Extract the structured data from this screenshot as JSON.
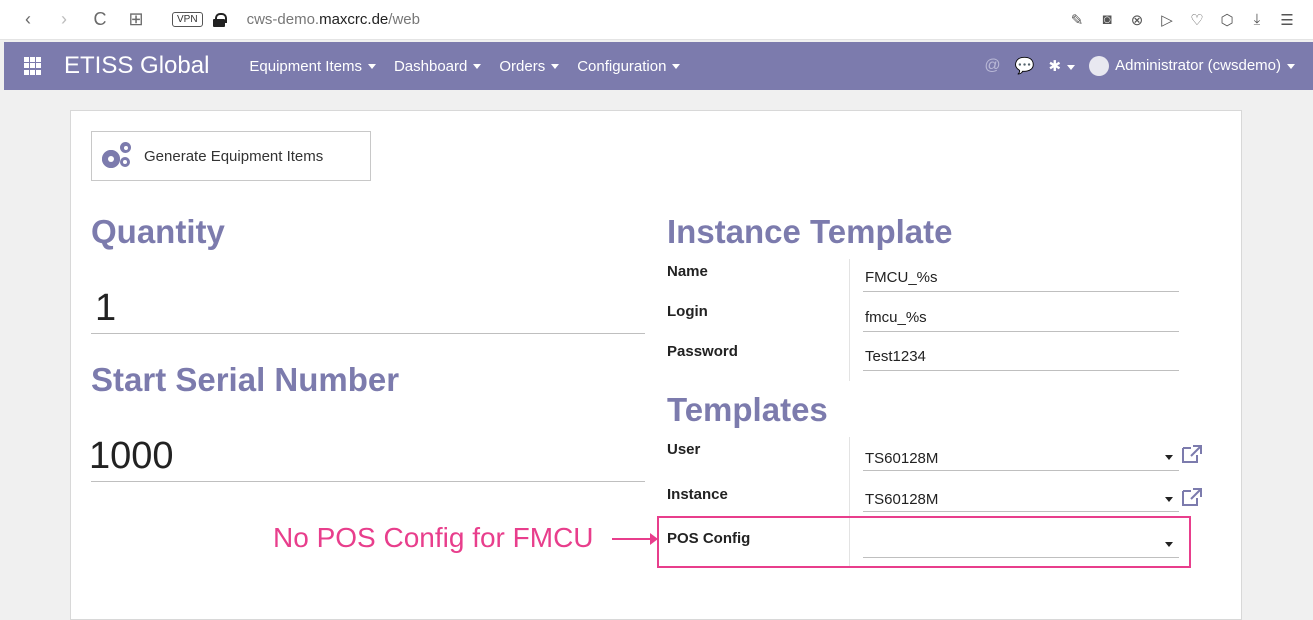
{
  "browser": {
    "back": "‹",
    "forward": "›",
    "reload": "C",
    "vpn_label": "VPN",
    "url_prefix": "cws-demo.",
    "url_domain": "maxcrc.de",
    "url_path": "/web"
  },
  "navbar": {
    "brand": "ETISS Global",
    "menu": [
      {
        "label": "Equipment Items"
      },
      {
        "label": "Dashboard"
      },
      {
        "label": "Orders"
      },
      {
        "label": "Configuration"
      }
    ],
    "user": "Administrator (cwsdemo)"
  },
  "form": {
    "generate_button": "Generate Equipment Items",
    "quantity_label": "Quantity",
    "quantity_value": "1",
    "serial_label": "Start Serial Number",
    "serial_value": "1000",
    "instance_template_title": "Instance Template",
    "name_label": "Name",
    "name_value": "FMCU_%s",
    "login_label": "Login",
    "login_value": "fmcu_%s",
    "password_label": "Password",
    "password_value": "Test1234",
    "templates_title": "Templates",
    "user_label": "User",
    "user_value": "TS60128M",
    "instance_label": "Instance",
    "instance_value": "TS60128M",
    "pos_config_label": "POS Config",
    "pos_config_value": ""
  },
  "annotation": {
    "text": "No POS Config for FMCU",
    "color": "#e83e8c"
  },
  "colors": {
    "brand": "#7c7bad",
    "heading": "#7c7bad"
  }
}
